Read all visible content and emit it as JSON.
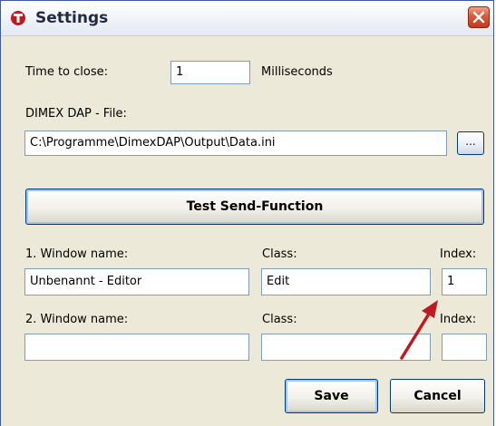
{
  "window": {
    "title": "Settings"
  },
  "time_to_close": {
    "label": "Time to close:",
    "value": "1",
    "unit": "Milliseconds"
  },
  "file": {
    "label": "DIMEX DAP - File:",
    "value": "C:\\Programme\\DimexDAP\\Output\\Data.ini",
    "browse_label": "..."
  },
  "test_button": {
    "label": "Test Send-Function"
  },
  "row1": {
    "window_label": "1. Window name:",
    "window_value": "Unbenannt - Editor",
    "class_label": "Class:",
    "class_value": "Edit",
    "index_label": "Index:",
    "index_value": "1"
  },
  "row2": {
    "window_label": "2. Window name:",
    "window_value": "",
    "class_label": "Class:",
    "class_value": "",
    "index_label": "Index:",
    "index_value": ""
  },
  "buttons": {
    "save": "Save",
    "cancel": "Cancel"
  },
  "colors": {
    "arrow": "#c0191f",
    "accent": "#003c74",
    "close": "#dc5a3a"
  }
}
